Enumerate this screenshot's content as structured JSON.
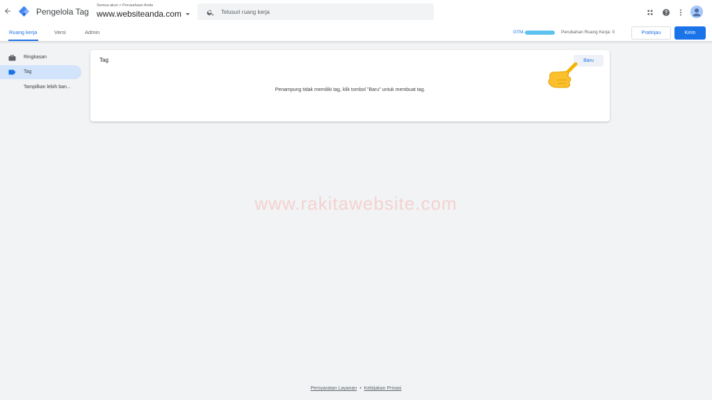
{
  "header": {
    "back_icon": "arrow-left-icon",
    "app_title": "Pengelola Tag",
    "account_breadcrumb": "Semua akun > Perusahaan Anda",
    "container_name": "www.websiteanda.com",
    "search_placeholder": "Telusuri ruang kerja",
    "icons": [
      "apps-grid-icon",
      "help-icon",
      "more-vert-icon",
      "avatar"
    ]
  },
  "navbar": {
    "tabs": [
      {
        "label": "Ruang kerja",
        "active": true
      },
      {
        "label": "Versi",
        "active": false
      },
      {
        "label": "Admin",
        "active": false
      }
    ],
    "container_id_prefix": "GTM-",
    "workspace_changes": "Perubahan Ruang Kerja: 0",
    "preview_label": "Pratinjau",
    "submit_label": "Kirim"
  },
  "sidebar": {
    "items": [
      {
        "label": "Ringkasan",
        "icon": "briefcase-icon",
        "active": false
      },
      {
        "label": "Tag",
        "icon": "tag-icon",
        "active": true
      },
      {
        "label": "Tampilkan lebih ban...",
        "icon": "",
        "active": false
      }
    ]
  },
  "card": {
    "title": "Tag",
    "new_label": "Baru",
    "empty_message": "Penampung tidak memiliki tag, klik tombol \"Baru\" untuk membuat tag."
  },
  "watermark": "www.rakitawebsite.com",
  "footer": {
    "terms": "Persyaratan Layanan",
    "separator": "•",
    "privacy": "Kebijakan Privasi"
  },
  "colors": {
    "accent": "#1a73e8",
    "sidebar_active": "#d2e3fc",
    "background": "#f1f3f4"
  }
}
